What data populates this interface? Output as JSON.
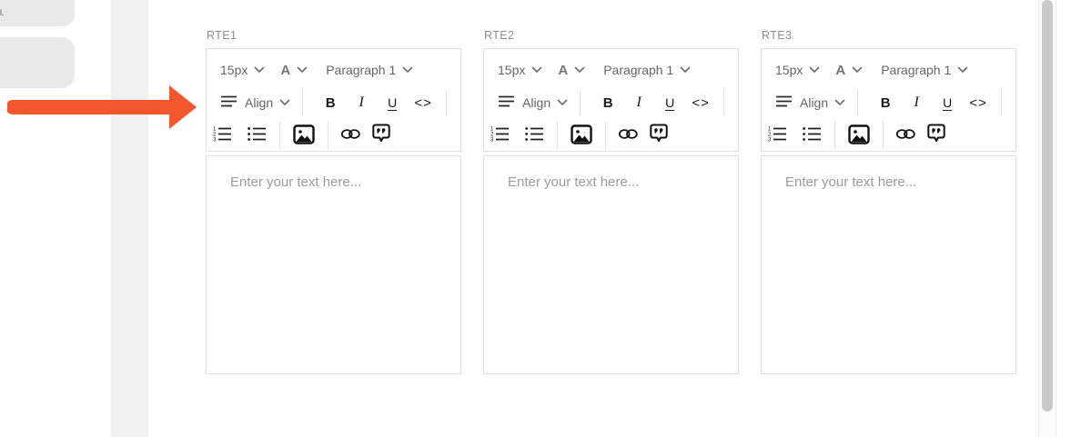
{
  "page": {
    "background": "#ffffff"
  },
  "left_panel": {
    "truncated_text": "l.",
    "pill_color": "#e9e9e9",
    "strip_color": "#f0f0f0"
  },
  "annotation": {
    "type": "arrow-right",
    "color": "#f4572d",
    "points_at": "RTE1 toolbar"
  },
  "editors": [
    {
      "label": "RTE1",
      "placeholder": "Enter your text here..."
    },
    {
      "label": "RTE2",
      "placeholder": "Enter your text here..."
    },
    {
      "label": "RTE3",
      "placeholder": "Enter your text here..."
    }
  ],
  "toolbar": {
    "font_size": "15px",
    "font_color": "A",
    "paragraph_format": "Paragraph 1",
    "align": "Align",
    "bold": "B",
    "italic": "I",
    "underline": "U",
    "code": "<>",
    "icons": [
      "chevron-down-icon",
      "align-left-icon",
      "ordered-list-icon",
      "unordered-list-icon",
      "image-icon",
      "link-icon",
      "quote-icon"
    ]
  },
  "scrollbar": {
    "thumb_color": "#c9c9c9",
    "orientation": "vertical"
  },
  "colors": {
    "box_border": "#e1e1e1",
    "toolbar_text": "#666666",
    "label_text": "#8e8e8e",
    "placeholder_text": "#9b9b9b",
    "icon_black": "#1b1b1b",
    "arrow_accent": "#f4572d"
  }
}
